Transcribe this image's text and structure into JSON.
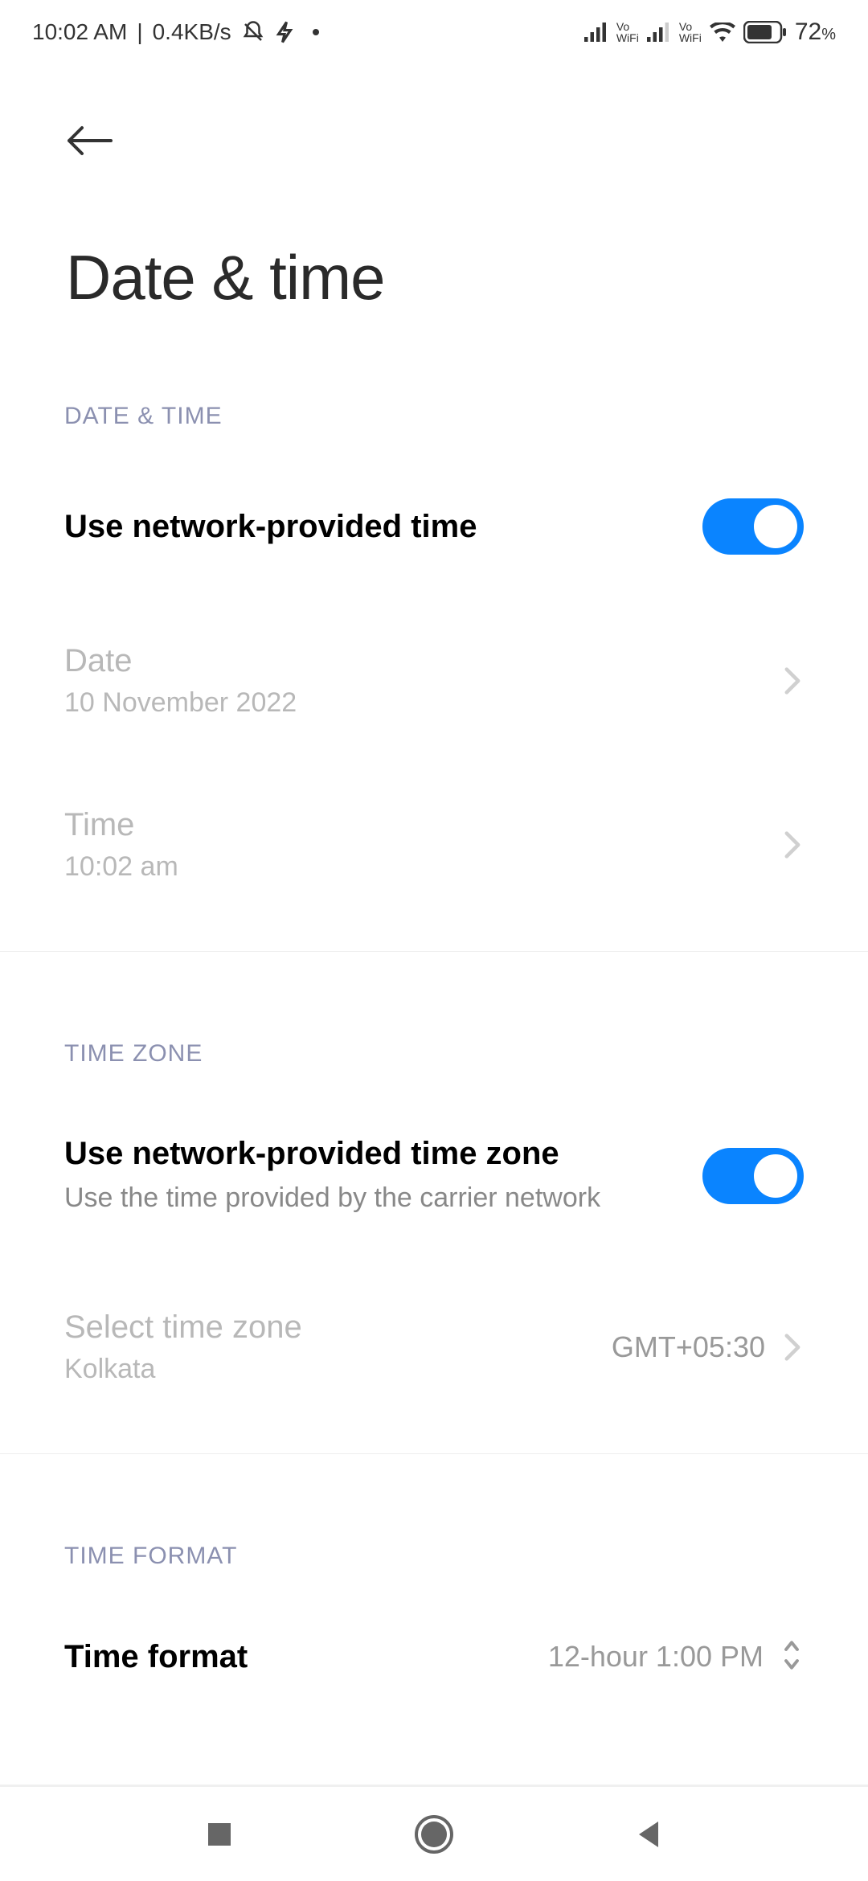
{
  "statusbar": {
    "time": "10:02 AM",
    "network_speed": "0.4KB/s",
    "battery_percent": "72",
    "battery_percent_sign": "%"
  },
  "header": {
    "title": "Date & time"
  },
  "sections": {
    "datetime": {
      "header": "DATE & TIME",
      "rows": {
        "network_time": {
          "title": "Use network-provided time",
          "toggle": true
        },
        "date": {
          "title": "Date",
          "value": "10 November 2022"
        },
        "time": {
          "title": "Time",
          "value": "10:02 am"
        }
      }
    },
    "timezone": {
      "header": "TIME ZONE",
      "rows": {
        "network_tz": {
          "title": "Use network-provided time zone",
          "desc": "Use the time provided by the carrier network",
          "toggle": true
        },
        "select_tz": {
          "title": "Select time zone",
          "sub": "Kolkata",
          "value": "GMT+05:30"
        }
      }
    },
    "timeformat": {
      "header": "TIME FORMAT",
      "rows": {
        "format": {
          "title": "Time format",
          "value": "12-hour 1:00 PM"
        }
      }
    }
  }
}
